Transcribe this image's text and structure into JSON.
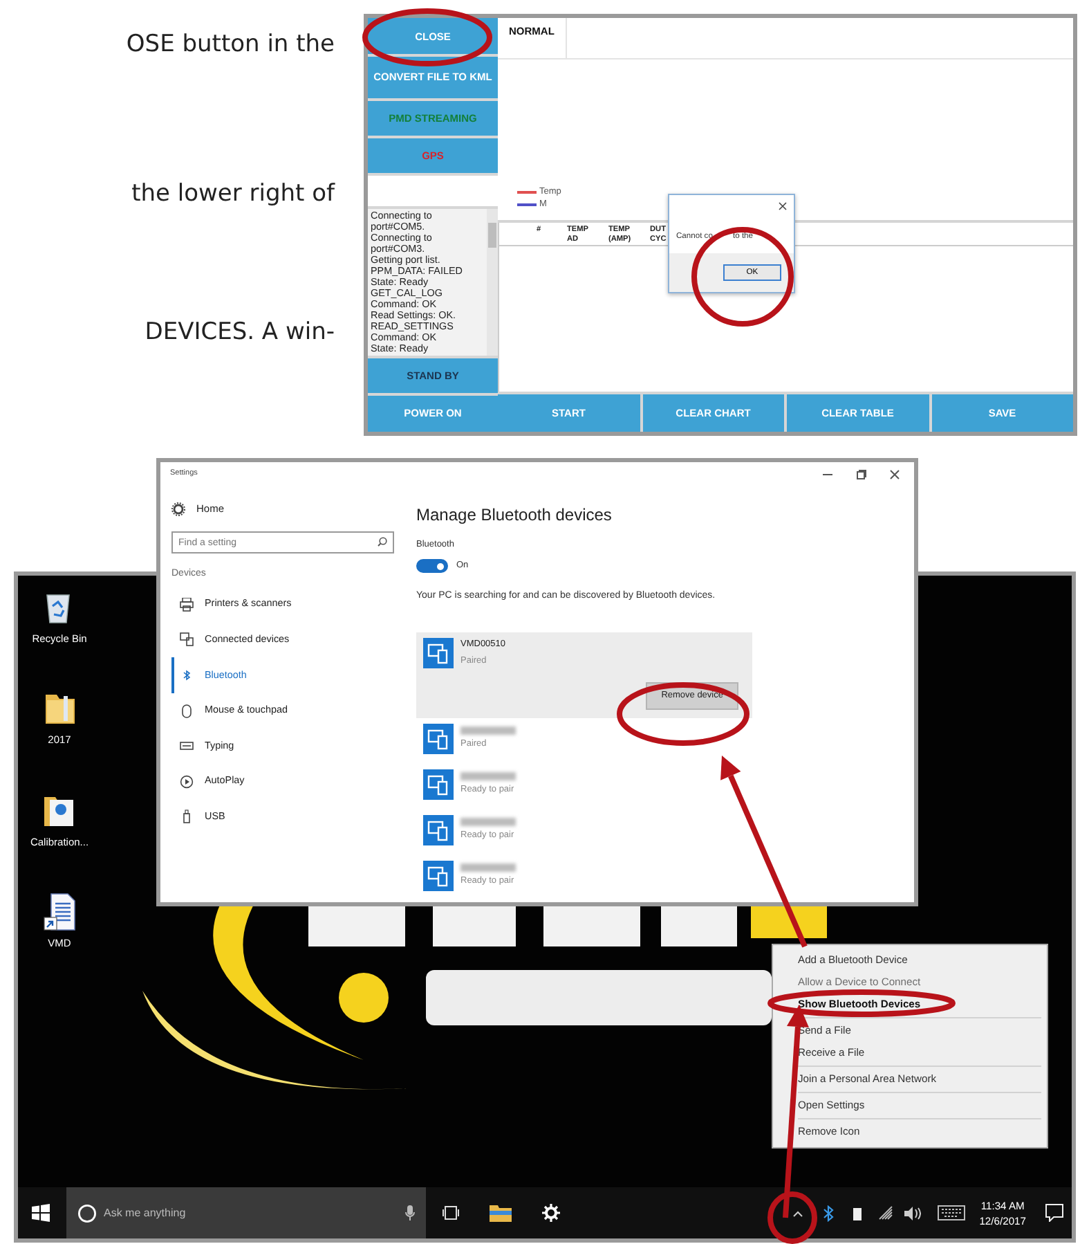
{
  "document_text": {
    "lines": [
      "OSE button in the",
      "the lower right of",
      "DEVICES. A win-"
    ]
  },
  "app_window": {
    "sidebar_top": [
      {
        "label": "CLOSE",
        "kind": "plain"
      },
      {
        "label": "CONVERT FILE TO KML",
        "kind": "plain"
      },
      {
        "label": "PMD STREAMING",
        "kind": "streaming"
      },
      {
        "label": "GPS",
        "kind": "alert"
      }
    ],
    "log": [
      "Connecting to port#COM5.",
      "Connecting to port#COM3.",
      "Getting port list.",
      "PPM_DATA: FAILED",
      "State: Ready",
      "GET_CAL_LOG",
      "Command: OK",
      "Read Settings: OK.",
      "READ_SETTINGS",
      "Command: OK",
      "State: Ready"
    ],
    "sidebar_bottom": [
      {
        "label": "STAND BY",
        "kind": "dim"
      },
      {
        "label": "POWER ON",
        "kind": "plain"
      }
    ],
    "tabs": [
      {
        "label": "NORMAL",
        "selected": true
      }
    ],
    "legend": [
      {
        "label": "Temp",
        "color": "#e05050"
      },
      {
        "label": "M",
        "color": "#5050c8"
      }
    ],
    "table": {
      "columns": [
        "#",
        "TEMP AD",
        "TEMP (AMP)",
        "DUT CYC"
      ]
    },
    "dialog": {
      "message_parts": [
        "Cannot co",
        "to the"
      ],
      "button": "OK"
    },
    "actions": [
      "START",
      "CLEAR CHART",
      "CLEAR TABLE",
      "SAVE"
    ]
  },
  "desktop": {
    "icons": [
      {
        "label": "Recycle Bin",
        "kind": "bin"
      },
      {
        "label": "2017",
        "kind": "folder"
      },
      {
        "label": "Calibration...",
        "kind": "folder_doc"
      },
      {
        "label": "VMD",
        "kind": "shortcut_doc"
      }
    ],
    "taskbar": {
      "search_placeholder": "Ask me anything",
      "time": "11:34 AM",
      "date": "12/6/2017"
    },
    "context_menu": [
      {
        "kind": "item",
        "label": "Add a Bluetooth Device",
        "disabled": false,
        "default": false
      },
      {
        "kind": "item",
        "label": "Allow a Device to Connect",
        "disabled": true,
        "default": false
      },
      {
        "kind": "item",
        "label": "Show Bluetooth Devices",
        "disabled": false,
        "default": true
      },
      {
        "kind": "separator"
      },
      {
        "kind": "item",
        "label": "Send a File",
        "disabled": false,
        "default": false
      },
      {
        "kind": "item",
        "label": "Receive a File",
        "disabled": false,
        "default": false
      },
      {
        "kind": "separator"
      },
      {
        "kind": "item",
        "label": "Join a Personal Area Network",
        "disabled": false,
        "default": false
      },
      {
        "kind": "separator"
      },
      {
        "kind": "item",
        "label": "Open Settings",
        "disabled": false,
        "default": false
      },
      {
        "kind": "separator"
      },
      {
        "kind": "item",
        "label": "Remove Icon",
        "disabled": false,
        "default": false
      }
    ]
  },
  "settings_window": {
    "title": "Settings",
    "home": "Home",
    "search": {
      "placeholder": "Find a setting"
    },
    "section": "Devices",
    "nav": [
      {
        "label": "Printers & scanners",
        "selected": false
      },
      {
        "label": "Connected devices",
        "selected": false
      },
      {
        "label": "Bluetooth",
        "selected": true
      },
      {
        "label": "Mouse & touchpad",
        "selected": false
      },
      {
        "label": "Typing",
        "selected": false
      },
      {
        "label": "AutoPlay",
        "selected": false
      },
      {
        "label": "USB",
        "selected": false
      }
    ],
    "heading": "Manage Bluetooth devices",
    "bluetooth_label": "Bluetooth",
    "toggle": {
      "on": true,
      "label": "On"
    },
    "description": "Your PC is searching for and can be discovered by Bluetooth devices.",
    "devices": [
      {
        "name": "VMD00510",
        "status": "Paired",
        "selected": true,
        "action": "Remove device"
      },
      {
        "status": "Paired",
        "selected": false
      },
      {
        "status": "Ready to pair",
        "selected": false
      },
      {
        "status": "Ready to pair",
        "selected": false
      },
      {
        "status": "Ready to pair",
        "selected": false
      }
    ]
  }
}
